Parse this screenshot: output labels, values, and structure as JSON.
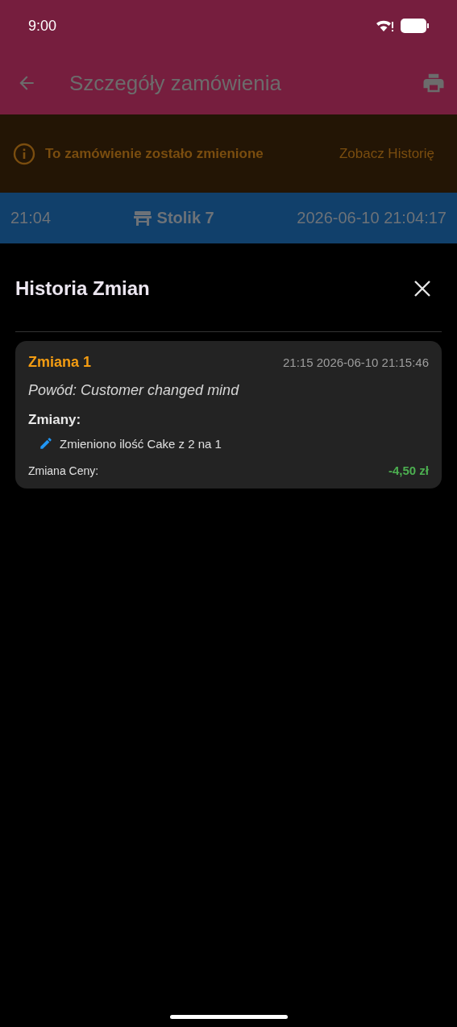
{
  "status_bar": {
    "time": "9:00"
  },
  "app_bar": {
    "title": "Szczegóły zamówienia"
  },
  "banner": {
    "message": "To zamówienie zostało zmienione",
    "action": "Zobacz Historię"
  },
  "order_strip": {
    "time": "21:04",
    "table": "Stolik 7",
    "datetime": "2026-06-10 21:04:17"
  },
  "sheet": {
    "title": "Historia Zmian",
    "entries": [
      {
        "title": "Zmiana 1",
        "timestamp": "21:15 2026-06-10 21:15:46",
        "reason": "Powód: Customer changed mind",
        "changes_label": "Zmiany:",
        "changes": [
          "Zmieniono ilość Cake z 2 na 1"
        ],
        "price_label": "Zmiana Ceny:",
        "price_change": "-4,50 zł"
      }
    ]
  }
}
